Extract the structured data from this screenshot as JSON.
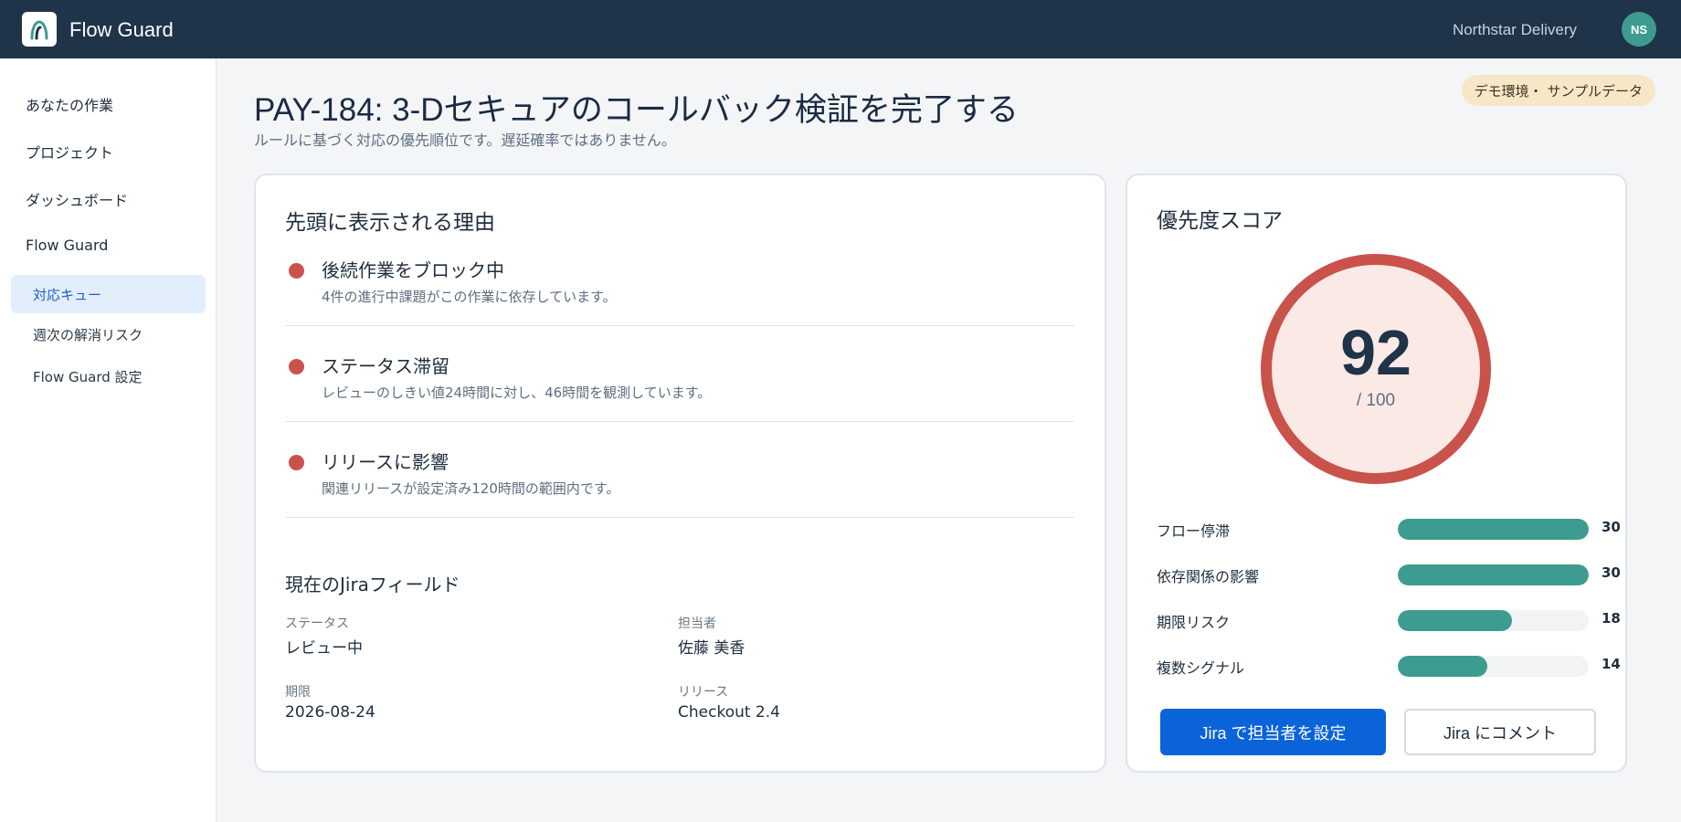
{
  "header": {
    "app_title": "Flow Guard",
    "org_name": "Northstar Delivery",
    "avatar_initials": "NS"
  },
  "sidebar": {
    "items": [
      {
        "label": "あなたの作業"
      },
      {
        "label": "プロジェクト"
      },
      {
        "label": "ダッシュボード"
      },
      {
        "label": "Flow Guard"
      }
    ],
    "sub_items": [
      {
        "label": "対応キュー",
        "active": true
      },
      {
        "label": "週次の解消リスク"
      },
      {
        "label": "Flow Guard 設定"
      }
    ]
  },
  "page": {
    "title": "PAY-184: 3-Dセキュアのコールバック検証を完了する",
    "subtitle": "ルールに基づく対応の優先順位です。遅延確率ではありません。",
    "badge": "デモ環境・ サンプルデータ"
  },
  "reasons": {
    "heading": "先頭に表示される理由",
    "items": [
      {
        "title": "後続作業をブロック中",
        "description": "4件の進行中課題がこの作業に依存しています。"
      },
      {
        "title": "ステータス滞留",
        "description": "レビューのしきい値24時間に対し、46時間を観測しています。"
      },
      {
        "title": "リリースに影響",
        "description": "関連リリースが設定済み120時間の範囲内です。"
      }
    ]
  },
  "jira_fields": {
    "heading": "現在のJiraフィールド",
    "status_label": "ステータス",
    "status_value": "レビュー中",
    "assignee_label": "担当者",
    "assignee_value": "佐藤 美香",
    "due_label": "期限",
    "due_value": "2026-08-24",
    "release_label": "リリース",
    "release_value": "Checkout 2.4"
  },
  "score": {
    "heading": "優先度スコア",
    "value": "92",
    "max_text": "/ 100",
    "ring_color": "#c9524b",
    "ring_bg": "#fbe9e6",
    "factors": [
      {
        "label": "フロー停滞",
        "value": 30,
        "fill_fraction": 1.0
      },
      {
        "label": "依存関係の影響",
        "value": 30,
        "fill_fraction": 1.0
      },
      {
        "label": "期限リスク",
        "value": 18,
        "fill_fraction": 0.6
      },
      {
        "label": "複数シグナル",
        "value": 14,
        "fill_fraction": 0.47
      }
    ]
  },
  "actions": {
    "assign_label": "Jira で担当者を設定",
    "comment_label": "Jira にコメント"
  },
  "colors": {
    "header_bg": "#1f3349",
    "accent": "#0a63d8",
    "teal": "#3d9c8f",
    "alert": "#c9524b"
  }
}
